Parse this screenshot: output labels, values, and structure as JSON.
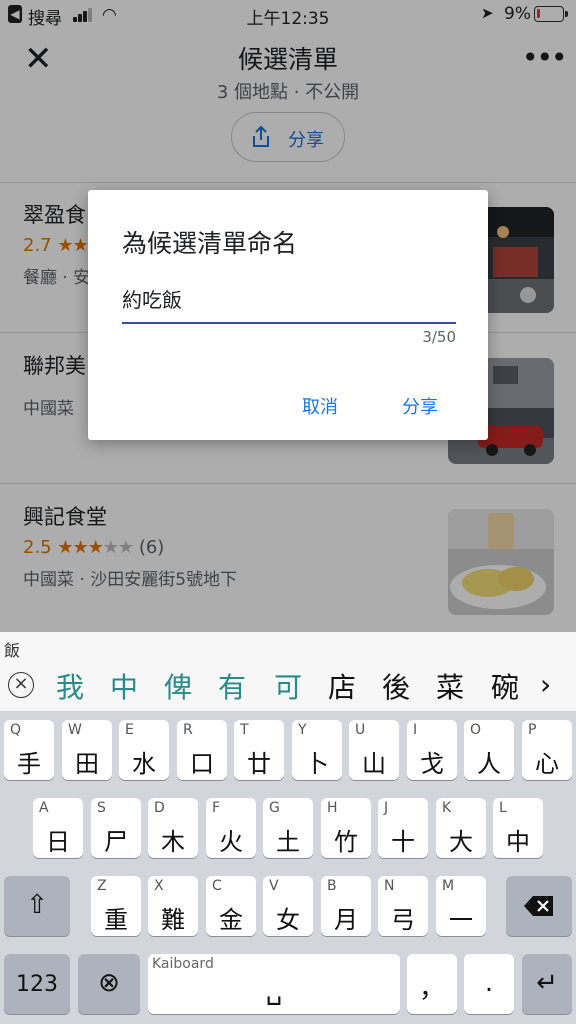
{
  "status_bar": {
    "carrier": "搜尋",
    "time": "上午12:35",
    "battery_pct": "9%",
    "battery_level": 0.09,
    "signal_bars": 3
  },
  "header": {
    "title": "候選清單",
    "subtitle": "3 個地點 · 不公開",
    "share_label": "分享",
    "close_icon": "close-icon",
    "more_icon": "more-horiz-icon"
  },
  "places": [
    {
      "name": "翠盈食",
      "rating": "2.7",
      "stars": 2.7,
      "count": "",
      "info": "餐廳 · 安"
    },
    {
      "name": "聯邦美",
      "rating": "",
      "stars": 0,
      "count": "",
      "info": "中國菜"
    },
    {
      "name": "興記食堂",
      "rating": "2.5",
      "stars": 2.5,
      "count": "(6)",
      "info": "中國菜 · 沙田安麗街5號地下"
    }
  ],
  "dialog": {
    "title": "為候選清單命名",
    "input_value": "約吃飯",
    "counter": "3/50",
    "cancel_label": "取消",
    "share_label": "分享"
  },
  "keyboard": {
    "composition": "飯",
    "candidates": [
      "我",
      "中",
      "俾",
      "有",
      "可",
      "店",
      "後",
      "菜",
      "碗"
    ],
    "row1": [
      {
        "l": "Q",
        "c": "手"
      },
      {
        "l": "W",
        "c": "田"
      },
      {
        "l": "E",
        "c": "水"
      },
      {
        "l": "R",
        "c": "口"
      },
      {
        "l": "T",
        "c": "廿"
      },
      {
        "l": "Y",
        "c": "卜"
      },
      {
        "l": "U",
        "c": "山"
      },
      {
        "l": "I",
        "c": "戈"
      },
      {
        "l": "O",
        "c": "人"
      },
      {
        "l": "P",
        "c": "心"
      }
    ],
    "row2": [
      {
        "l": "A",
        "c": "日"
      },
      {
        "l": "S",
        "c": "尸"
      },
      {
        "l": "D",
        "c": "木"
      },
      {
        "l": "F",
        "c": "火"
      },
      {
        "l": "G",
        "c": "土"
      },
      {
        "l": "H",
        "c": "竹"
      },
      {
        "l": "J",
        "c": "十"
      },
      {
        "l": "K",
        "c": "大"
      },
      {
        "l": "L",
        "c": "中"
      }
    ],
    "row3": [
      {
        "l": "Z",
        "c": "重"
      },
      {
        "l": "X",
        "c": "難"
      },
      {
        "l": "C",
        "c": "金"
      },
      {
        "l": "V",
        "c": "女"
      },
      {
        "l": "B",
        "c": "月"
      },
      {
        "l": "N",
        "c": "弓"
      },
      {
        "l": "M",
        "c": "一"
      }
    ],
    "numbers_label": "123",
    "space_brand": "Kaiboard",
    "space_glyph": "␣",
    "comma": "，",
    "period": ".",
    "shift_glyph": "⇧",
    "return_glyph": "↵",
    "globe_glyph": "⊗"
  }
}
